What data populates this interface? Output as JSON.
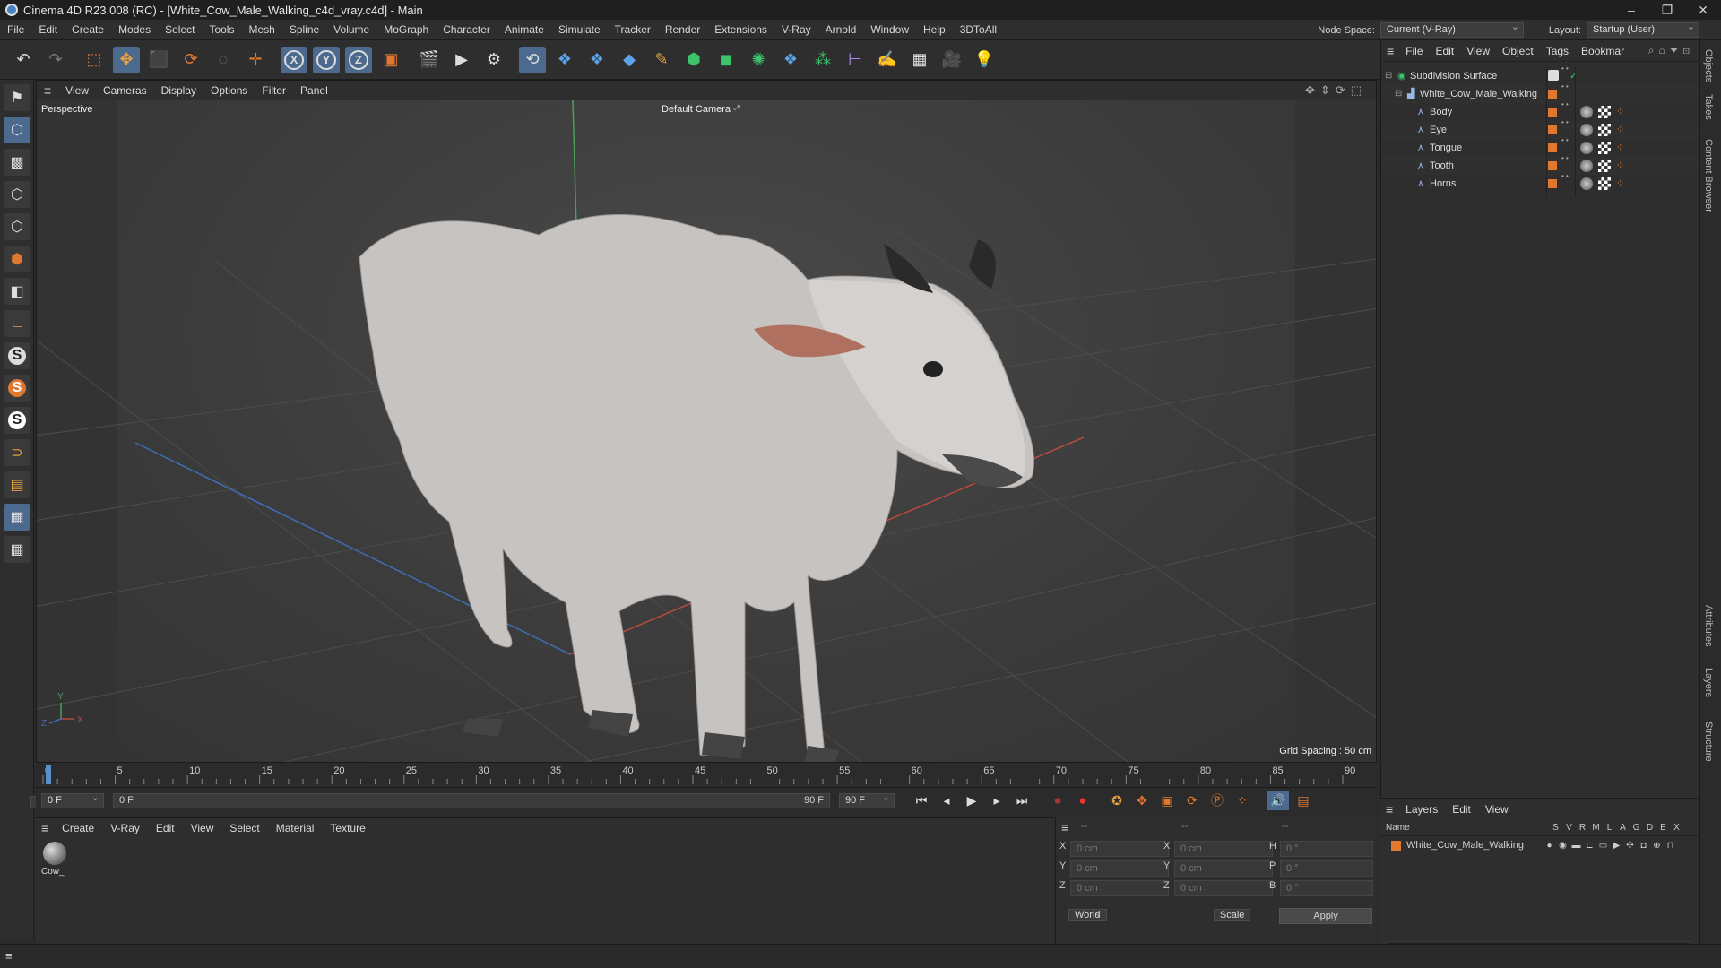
{
  "window": {
    "title": "Cinema 4D R23.008 (RC) - [White_Cow_Male_Walking_c4d_vray.c4d] - Main",
    "minimize": "–",
    "restore": "❐",
    "close": "✕"
  },
  "menubar": {
    "items": [
      "File",
      "Edit",
      "Create",
      "Modes",
      "Select",
      "Tools",
      "Mesh",
      "Spline",
      "Volume",
      "MoGraph",
      "Character",
      "Animate",
      "Simulate",
      "Tracker",
      "Render",
      "Extensions",
      "V-Ray",
      "Arnold",
      "Window",
      "Help",
      "3DToAll"
    ],
    "node_space_label": "Node Space:",
    "node_space_value": "Current (V-Ray)",
    "layout_label": "Layout:",
    "layout_value": "Startup (User)"
  },
  "toolbar": {
    "icons": [
      "undo-icon",
      "redo-icon",
      "live-selection-icon",
      "move-icon",
      "scale-icon",
      "rotate-icon",
      "select-circle-icon",
      "transform-icon",
      "x-axis-lock-icon",
      "y-axis-lock-icon",
      "z-axis-lock-icon",
      "coordinate-system-icon",
      "render-region-icon",
      "render-view-icon",
      "render-settings-icon",
      "vray-icon",
      "python-icon",
      "python-2-icon",
      "cube-icon",
      "pen-icon",
      "subdivision-icon",
      "extrude-icon",
      "cloner-icon",
      "python-3-icon",
      "mograph-icon",
      "deformer-icon",
      "sculpt-icon",
      "floor-icon",
      "camera-icon",
      "light-icon"
    ],
    "axis_labels": [
      "X",
      "Y",
      "Z"
    ]
  },
  "lefttools": {
    "icons": [
      "make-editable-icon",
      "model-mode-icon",
      "texture-mode-icon",
      "point-mode-icon",
      "edge-mode-icon",
      "polygon-mode-icon",
      "uvw-mode-icon",
      "axis-mode-icon",
      "snap-icon",
      "snap-2-icon",
      "snap-3-icon",
      "magnet-icon",
      "workplane-icon",
      "grid-icon",
      "quantize-icon"
    ],
    "s_glyph": "S"
  },
  "viewport": {
    "menu": [
      "View",
      "Cameras",
      "Display",
      "Options",
      "Filter",
      "Panel"
    ],
    "view_name": "Perspective",
    "camera_label": "Default Camera",
    "grid_spacing": "Grid Spacing : 50 cm",
    "axis": {
      "x": "X",
      "y": "Y",
      "z": "Z"
    }
  },
  "timeline": {
    "ticks": [
      "0",
      "5",
      "10",
      "15",
      "20",
      "25",
      "30",
      "35",
      "40",
      "45",
      "50",
      "55",
      "60",
      "65",
      "70",
      "75",
      "80",
      "85",
      "90"
    ],
    "current_frame_field": "0 F",
    "start_field": "0 F",
    "range_start": "0 F",
    "range_end": "90 F",
    "end_field": "90 F"
  },
  "materials": {
    "menu": [
      "Create",
      "V-Ray",
      "Edit",
      "View",
      "Select",
      "Material",
      "Texture"
    ],
    "items": [
      {
        "name": "Cow_"
      }
    ]
  },
  "coordinates": {
    "header": [
      "--",
      "--",
      "--"
    ],
    "rows": [
      {
        "l1": "X",
        "v1": "0 cm",
        "l2": "X",
        "v2": "0 cm",
        "l3": "H",
        "v3": "0 °"
      },
      {
        "l1": "Y",
        "v1": "0 cm",
        "l2": "Y",
        "v2": "0 cm",
        "l3": "P",
        "v3": "0 °"
      },
      {
        "l1": "Z",
        "v1": "0 cm",
        "l2": "Z",
        "v2": "0 cm",
        "l3": "B",
        "v3": "0 °"
      }
    ],
    "world": "World",
    "scale": "Scale",
    "apply": "Apply"
  },
  "objects": {
    "menu": [
      "File",
      "Edit",
      "View",
      "Object",
      "Tags",
      "Bookmar"
    ],
    "tree": [
      {
        "name": "Subdivision Surface",
        "level": 0,
        "icon": "subdivision-icon"
      },
      {
        "name": "White_Cow_Male_Walking",
        "level": 1,
        "icon": "null-icon"
      },
      {
        "name": "Body",
        "level": 2,
        "icon": "polygon-icon"
      },
      {
        "name": "Eye",
        "level": 2,
        "icon": "polygon-icon"
      },
      {
        "name": "Tongue",
        "level": 2,
        "icon": "polygon-icon"
      },
      {
        "name": "Tooth",
        "level": 2,
        "icon": "polygon-icon"
      },
      {
        "name": "Horns",
        "level": 2,
        "icon": "polygon-icon"
      }
    ]
  },
  "layers": {
    "menu": [
      "Layers",
      "Edit",
      "View"
    ],
    "columns": [
      "Name",
      "S",
      "V",
      "R",
      "M",
      "L",
      "A",
      "G",
      "D",
      "E",
      "X"
    ],
    "rows": [
      {
        "name": "White_Cow_Male_Walking"
      }
    ]
  },
  "side_tabs": [
    "Objects",
    "Takes",
    "Content Browser",
    "Attributes",
    "Layers",
    "Structure"
  ],
  "colors": {
    "accent": "#e2782f",
    "bg": "#2e2e2e",
    "viewport": "#3c3c3c"
  }
}
